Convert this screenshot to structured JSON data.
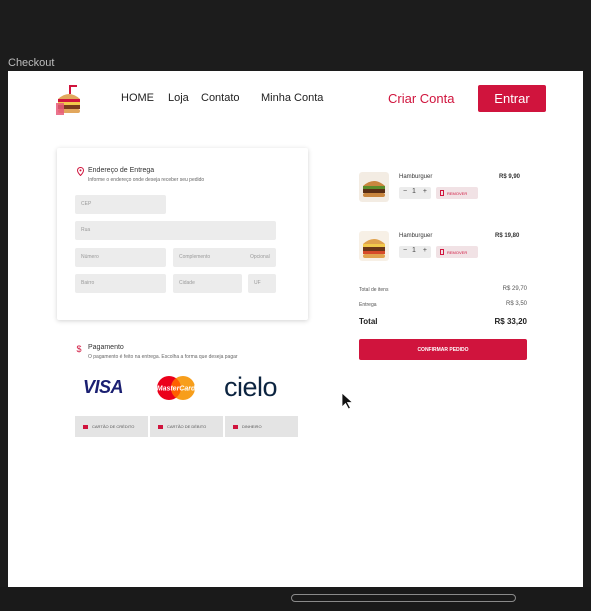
{
  "window": {
    "title": "Checkout"
  },
  "header": {
    "nav": [
      "HOME",
      "Loja",
      "Contato",
      "Minha Conta"
    ],
    "create_account": "Criar Conta",
    "login": "Entrar"
  },
  "delivery": {
    "title": "Endereço de Entrega",
    "subtitle": "Informe o endereço onde deseja receber seu pedido",
    "fields": {
      "cep": "CEP",
      "rua": "Rua",
      "numero": "Número",
      "complemento": "Complemento",
      "opcional": "Opcional",
      "bairro": "Bairro",
      "cidade": "Cidade",
      "uf": "UF"
    }
  },
  "payment": {
    "title": "Pagamento",
    "subtitle": "O pagamento é feito na entrega. Escolha a forma que deseja pagar",
    "brands": {
      "visa": "VISA",
      "mastercard": "MasterCard",
      "cielo": "cielo"
    },
    "options": [
      "CARTÃO DE CRÉDITO",
      "CARTÃO DE DÉBITO",
      "DINHEIRO"
    ]
  },
  "order": {
    "items": [
      {
        "name": "Hamburguer",
        "price": "R$ 9,90",
        "qty": "1",
        "remove": "REMOVER"
      },
      {
        "name": "Hamburguer",
        "price": "R$ 19,80",
        "qty": "1",
        "remove": "REMOVER"
      }
    ],
    "subtotal_label": "Total de itens",
    "subtotal_value": "R$ 29,70",
    "delivery_label": "Entrega",
    "delivery_value": "R$ 3,50",
    "total_label": "Total",
    "total_value": "R$ 33,20",
    "confirm": "CONFIRMAR PEDIDO"
  },
  "colors": {
    "accent": "#d0143d",
    "field_bg": "#ececec",
    "window_bg": "#1c1c1c"
  }
}
